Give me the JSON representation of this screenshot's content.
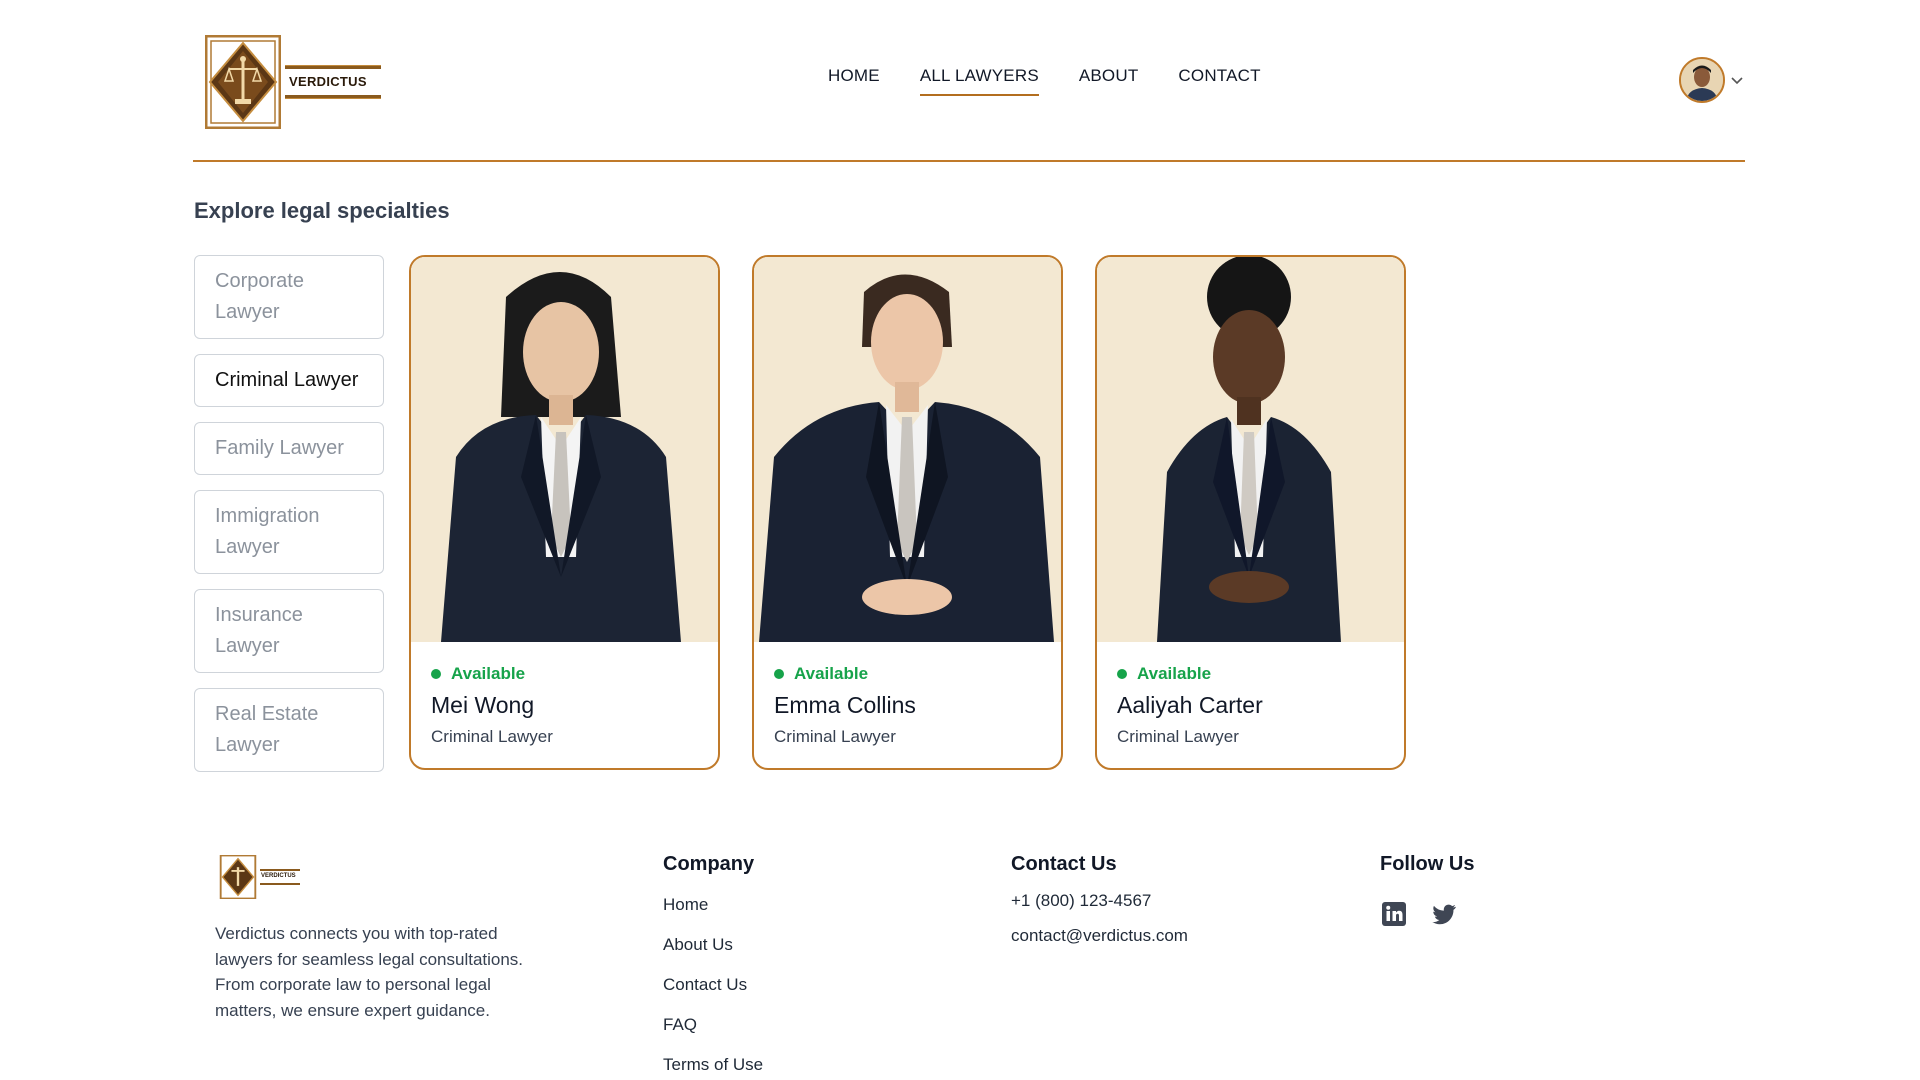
{
  "brand": {
    "name": "VERDICTUS"
  },
  "nav": {
    "items": [
      {
        "label": "HOME",
        "active": false
      },
      {
        "label": "ALL LAWYERS",
        "active": true
      },
      {
        "label": "ABOUT",
        "active": false
      },
      {
        "label": "CONTACT",
        "active": false
      }
    ]
  },
  "colors": {
    "accent": "#c07a2a",
    "available": "#16a34a",
    "card_bg": "#f3e8d2",
    "suit": "#1c2434"
  },
  "section": {
    "title": "Explore legal specialties"
  },
  "specialties": [
    {
      "label": "Corporate Lawyer",
      "active": false
    },
    {
      "label": "Criminal Lawyer",
      "active": true
    },
    {
      "label": "Family Lawyer",
      "active": false
    },
    {
      "label": "Immigration Lawyer",
      "active": false
    },
    {
      "label": "Insurance Lawyer",
      "active": false
    },
    {
      "label": "Real Estate Lawyer",
      "active": false
    }
  ],
  "lawyers": [
    {
      "status": "Available",
      "name": "Mei Wong",
      "speciality": "Criminal Lawyer"
    },
    {
      "status": "Available",
      "name": "Emma Collins",
      "speciality": "Criminal Lawyer"
    },
    {
      "status": "Available",
      "name": "Aaliyah Carter",
      "speciality": "Criminal Lawyer"
    }
  ],
  "footer": {
    "description": "Verdictus connects you with top-rated lawyers for seamless legal consultations. From corporate law to personal legal matters, we ensure expert guidance.",
    "company": {
      "title": "Company",
      "links": [
        "Home",
        "About Us",
        "Contact Us",
        "FAQ",
        "Terms of Use"
      ]
    },
    "contact": {
      "title": "Contact Us",
      "phone": "+1 (800) 123-4567",
      "email": "contact@verdictus.com"
    },
    "follow": {
      "title": "Follow Us",
      "icons": [
        "linkedin-icon",
        "twitter-icon"
      ]
    }
  }
}
